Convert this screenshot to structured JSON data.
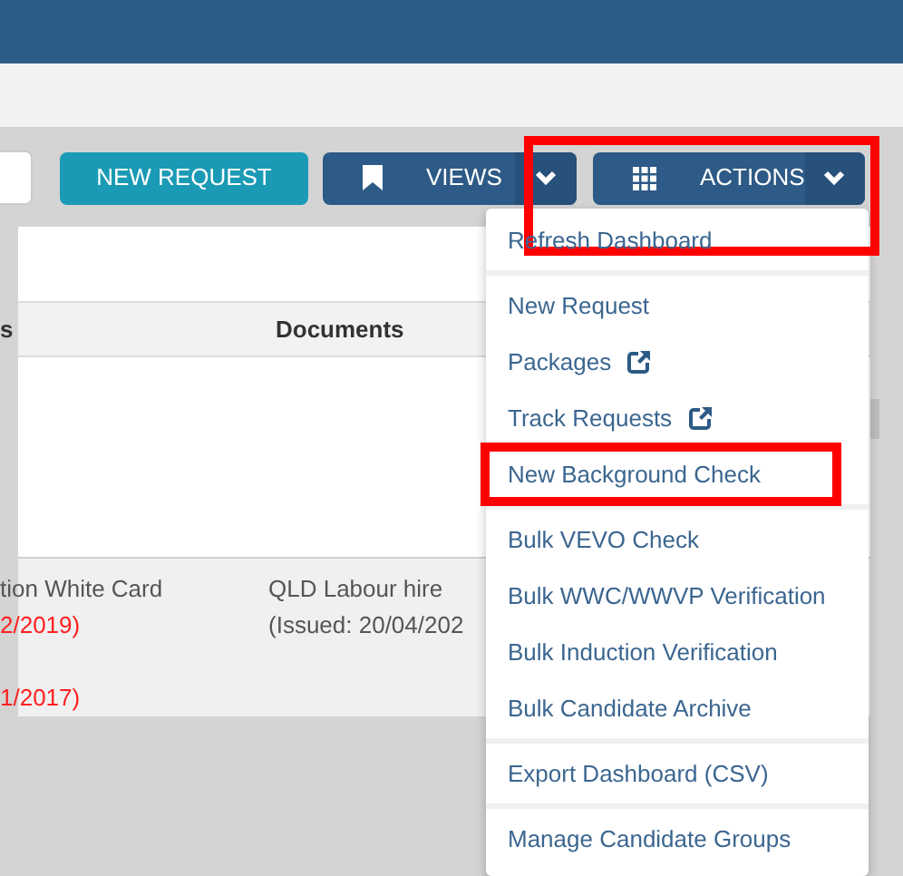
{
  "toolbar": {
    "buttons": [
      {
        "kind": "stub"
      },
      {
        "kind": "primary",
        "label": "NEW REQUEST"
      },
      {
        "kind": "dropdown",
        "label": "VIEWS",
        "highlighted": false
      },
      {
        "kind": "dropdown",
        "label": "ACTIONS",
        "highlighted": true
      }
    ]
  },
  "table": {
    "columns": [
      "s",
      "Documents"
    ],
    "rows": [
      {
        "cells": [
          {
            "lines": [
              {
                "text": "tion White Card",
                "expired": false
              },
              {
                "text": "2/2019)",
                "expired": true
              },
              {
                "text": "1/2017)",
                "expired": true
              }
            ]
          },
          {
            "lines": [
              {
                "text": "QLD Labour hire",
                "expired": false
              },
              {
                "text": "(Issued: 20/04/202",
                "expired": false
              }
            ]
          }
        ]
      }
    ]
  },
  "actions_menu": {
    "items": [
      {
        "kind": "item",
        "label": "Refresh Dashboard",
        "external": false,
        "highlighted": false
      },
      {
        "kind": "divider"
      },
      {
        "kind": "item",
        "label": "New Request",
        "external": false,
        "highlighted": false
      },
      {
        "kind": "item",
        "label": "Packages",
        "external": true,
        "highlighted": false
      },
      {
        "kind": "item",
        "label": "Track Requests",
        "external": true,
        "highlighted": false
      },
      {
        "kind": "item",
        "label": "New Background Check",
        "external": false,
        "highlighted": true
      },
      {
        "kind": "divider"
      },
      {
        "kind": "item",
        "label": "Bulk VEVO Check",
        "external": false,
        "highlighted": false
      },
      {
        "kind": "item",
        "label": "Bulk WWC/WWVP Verification",
        "external": false,
        "highlighted": false
      },
      {
        "kind": "item",
        "label": "Bulk Induction Verification",
        "external": false,
        "highlighted": false
      },
      {
        "kind": "item",
        "label": "Bulk Candidate Archive",
        "external": false,
        "highlighted": false
      },
      {
        "kind": "divider"
      },
      {
        "kind": "item",
        "label": "Export Dashboard (CSV)",
        "external": false,
        "highlighted": false
      },
      {
        "kind": "divider"
      },
      {
        "kind": "item",
        "label": "Manage Candidate Groups",
        "external": false,
        "highlighted": false
      }
    ]
  }
}
